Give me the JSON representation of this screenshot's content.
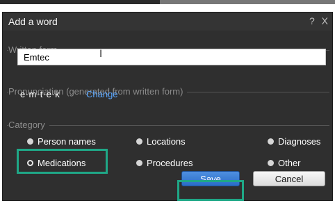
{
  "dialog": {
    "title": "Add a word",
    "help_icon": "?",
    "close_icon": "X"
  },
  "written_form": {
    "label": "Written form",
    "value": "Emtec"
  },
  "pronunciation": {
    "label": "Pronunciation (generated from written form)",
    "phonemes": "e·m·t·e·k",
    "change_label": "Change"
  },
  "category": {
    "label": "Category",
    "selected": "Medications",
    "options": [
      "Person names",
      "Locations",
      "Diagnoses",
      "Medications",
      "Procedures",
      "Other"
    ]
  },
  "buttons": {
    "save_label": "Save",
    "cancel_label": "Cancel"
  },
  "colors": {
    "dialog_bg": "#2f2f2f",
    "highlight": "#1fa887",
    "link": "#5aa7ff",
    "save_button": "#2a6dc7"
  }
}
